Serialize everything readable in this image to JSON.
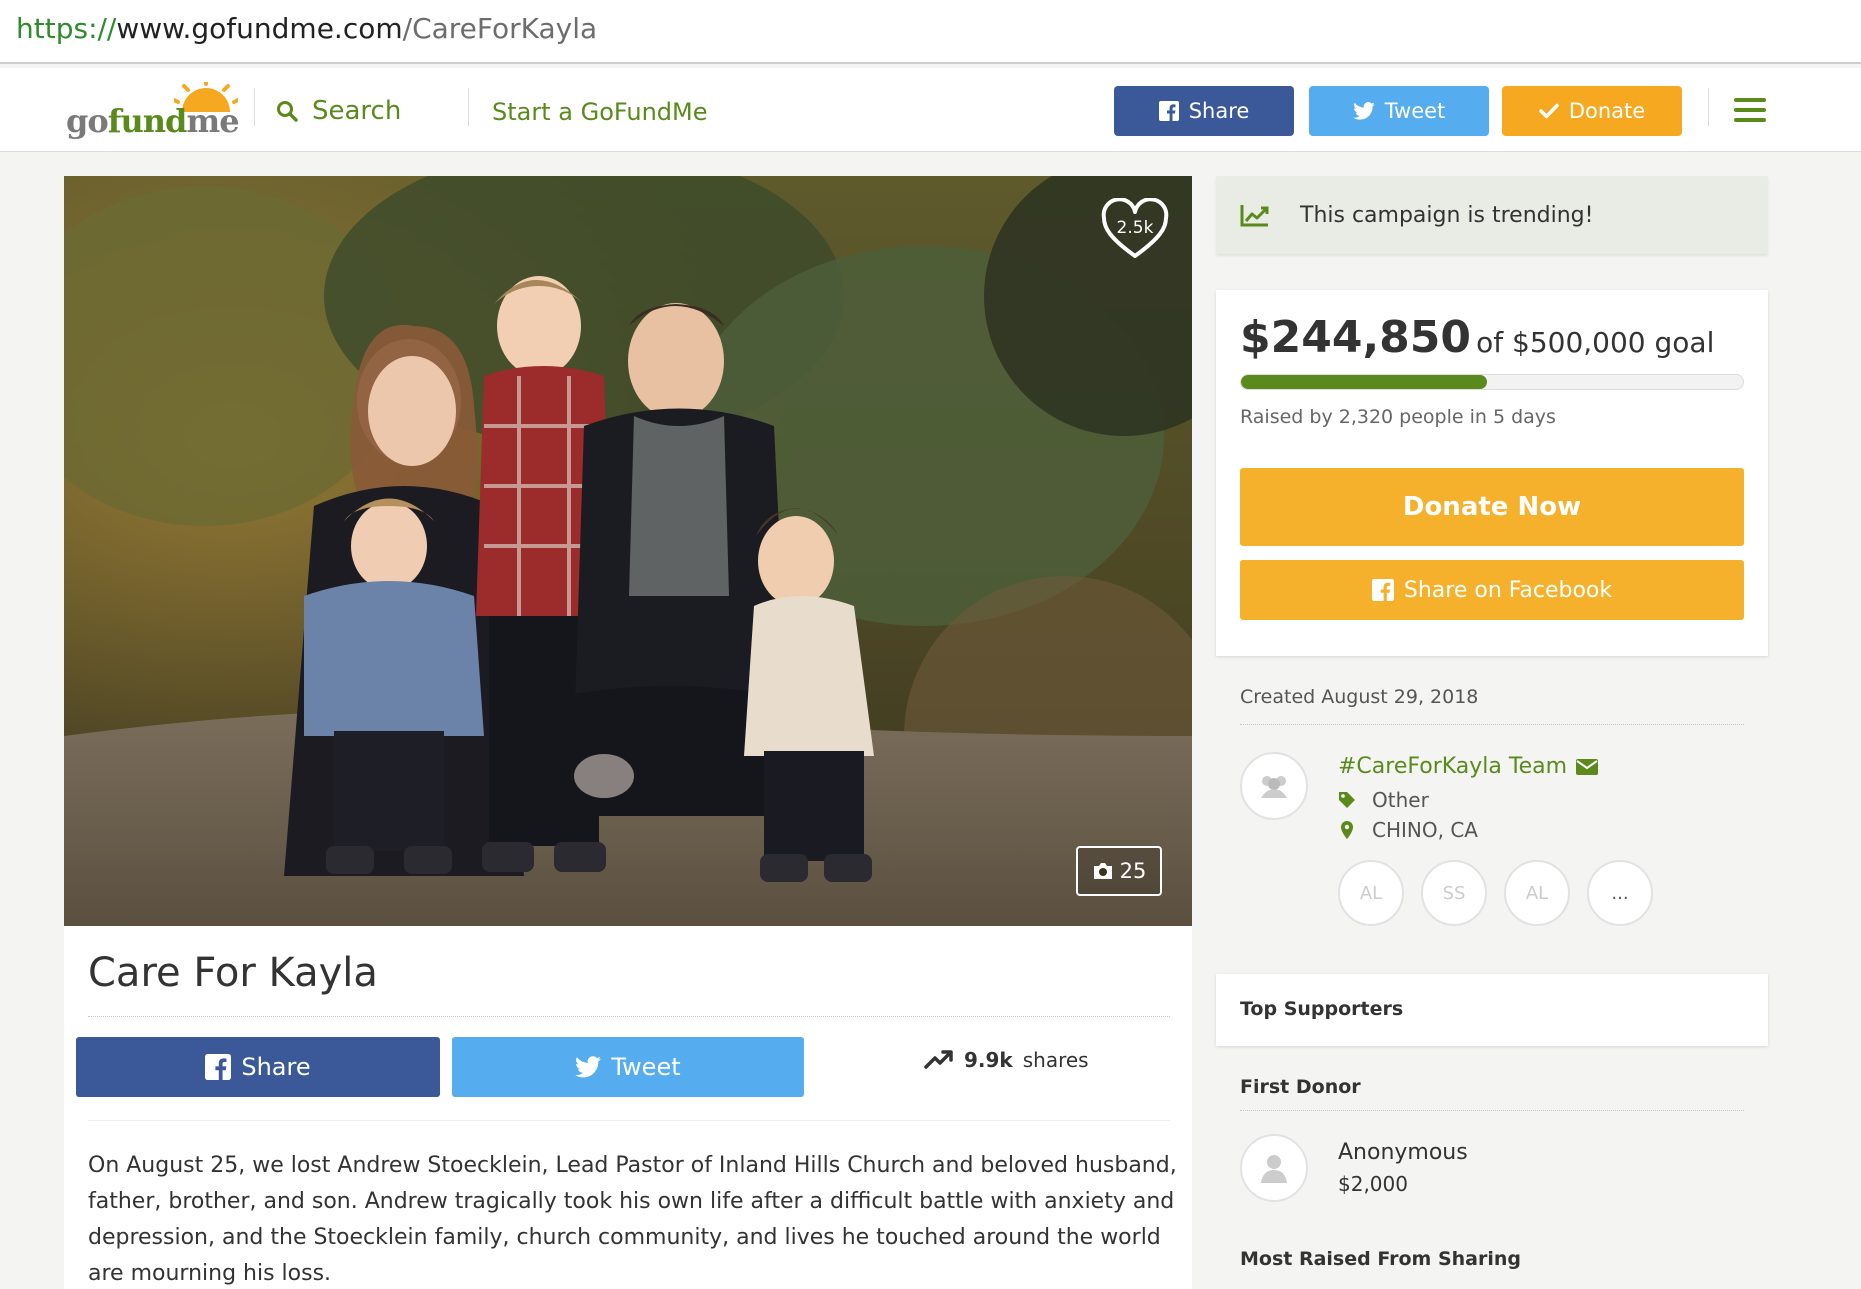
{
  "browser": {
    "url_scheme": "https://",
    "url_host": "www.gofundme.com",
    "url_path": "/CareForKayla"
  },
  "header": {
    "logo_go": "go",
    "logo_fund": "fund",
    "logo_me": "me",
    "search_label": "Search",
    "start_label": "Start a GoFundMe",
    "share_label": "Share",
    "tweet_label": "Tweet",
    "donate_label": "Donate"
  },
  "hero": {
    "hearts": "2.5k",
    "photo_count": "25"
  },
  "campaign": {
    "title": "Care For Kayla",
    "share_label": "Share",
    "tweet_label": "Tweet",
    "shares_count": "9.9k",
    "shares_suffix": "shares",
    "story": "On August 25, we lost Andrew Stoecklein, Lead Pastor of Inland Hills Church and beloved husband, father, brother, and son. Andrew tragically took his own life after a difficult battle with anxiety and depression, and the Stoecklein family, church community, and lives he touched around the world are mourning his loss."
  },
  "sidebar": {
    "trending": "This campaign is trending!",
    "raised_amount": "$244,850",
    "goal_text": "of $500,000 goal",
    "progress_fraction": 0.49,
    "raised_by": "Raised by 2,320 people in 5 days",
    "donate_now": "Donate Now",
    "share_facebook": "Share on Facebook",
    "created": "Created August 29, 2018",
    "organizer": "#CareForKayla Team",
    "category": "Other",
    "location": "CHINO, CA",
    "team": [
      "AL",
      "SS",
      "AL",
      "..."
    ],
    "top_supporters": "Top Supporters",
    "first_donor_label": "First Donor",
    "first_donor_name": "Anonymous",
    "first_donor_amount": "$2,000",
    "most_raised_label": "Most Raised From Sharing"
  },
  "colors": {
    "brand_green": "#5a8a1c",
    "facebook": "#3b5998",
    "twitter": "#55acee",
    "donate_orange": "#f6a820"
  }
}
